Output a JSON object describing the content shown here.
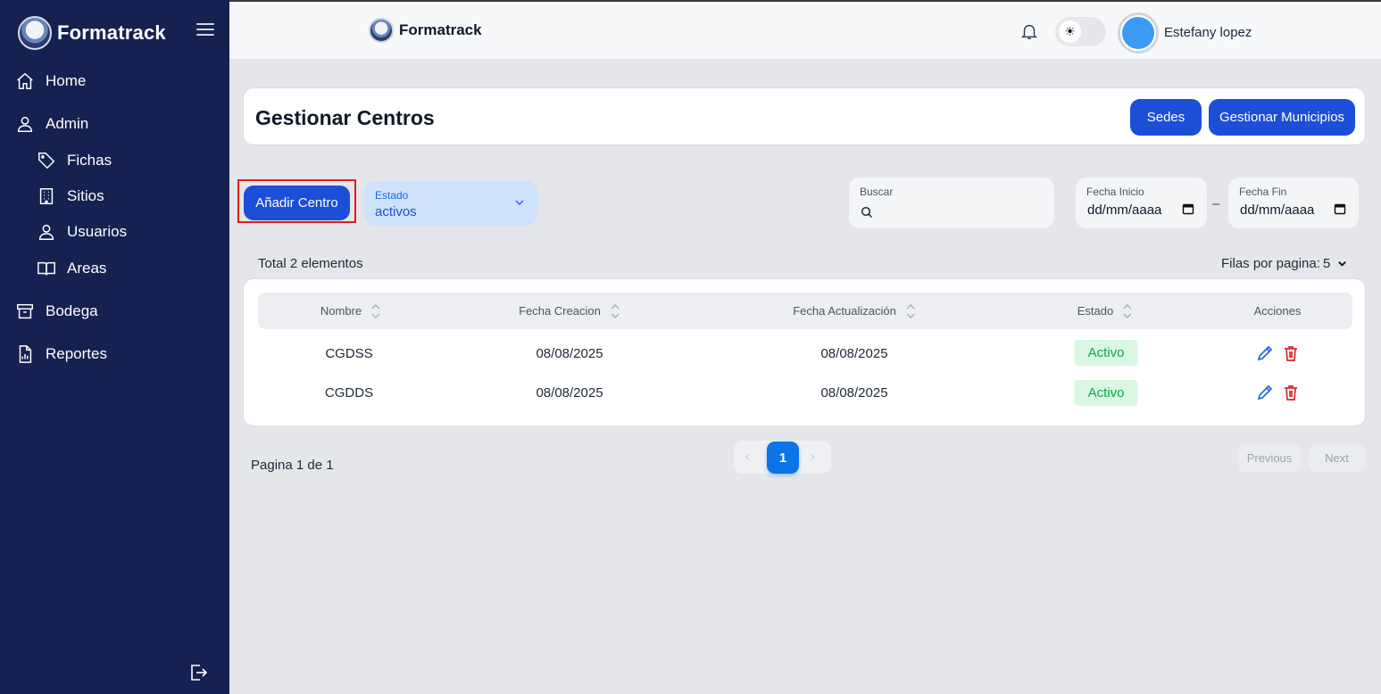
{
  "sidebar": {
    "brand": "Formatrack",
    "items": [
      {
        "label": "Home",
        "icon": "home-icon"
      },
      {
        "label": "Admin",
        "icon": "user-icon"
      },
      {
        "label": "Fichas",
        "icon": "tag-icon"
      },
      {
        "label": "Sitios",
        "icon": "building-icon"
      },
      {
        "label": "Usuarios",
        "icon": "user-icon"
      },
      {
        "label": "Areas",
        "icon": "book-icon"
      },
      {
        "label": "Bodega",
        "icon": "archive-icon"
      },
      {
        "label": "Reportes",
        "icon": "report-icon"
      }
    ]
  },
  "header": {
    "brand": "Formatrack",
    "user_name": "Estefany lopez"
  },
  "page": {
    "title": "Gestionar Centros",
    "sedes_label": "Sedes",
    "municipios_label": "Gestionar Municipios"
  },
  "filters": {
    "add_label": "Añadir Centro",
    "estado_label": "Estado",
    "estado_value": "activos",
    "buscar_label": "Buscar",
    "fecha_inicio_label": "Fecha Inicio",
    "fecha_inicio_value": "dd/mm/aaaa",
    "fecha_fin_label": "Fecha Fin",
    "fecha_fin_value": "dd/mm/aaaa",
    "dash": "–"
  },
  "summary": {
    "total": "Total 2 elementos",
    "rows_label": "Filas por pagina:",
    "rows_value": "5"
  },
  "table": {
    "columns": [
      "Nombre",
      "Fecha Creacion",
      "Fecha Actualización",
      "Estado",
      "Acciones"
    ],
    "rows": [
      {
        "nombre": "CGDSS",
        "creacion": "08/08/2025",
        "actualizacion": "08/08/2025",
        "estado": "Activo"
      },
      {
        "nombre": "CGDDS",
        "creacion": "08/08/2025",
        "actualizacion": "08/08/2025",
        "estado": "Activo"
      }
    ]
  },
  "pagination": {
    "info": "Pagina 1 de 1",
    "current": "1",
    "previous": "Previous",
    "next": "Next"
  },
  "colors": {
    "sidebar_bg": "#152251",
    "primary": "#1d4ed8",
    "status_active": "#16a34a",
    "delete": "#dc2626"
  }
}
